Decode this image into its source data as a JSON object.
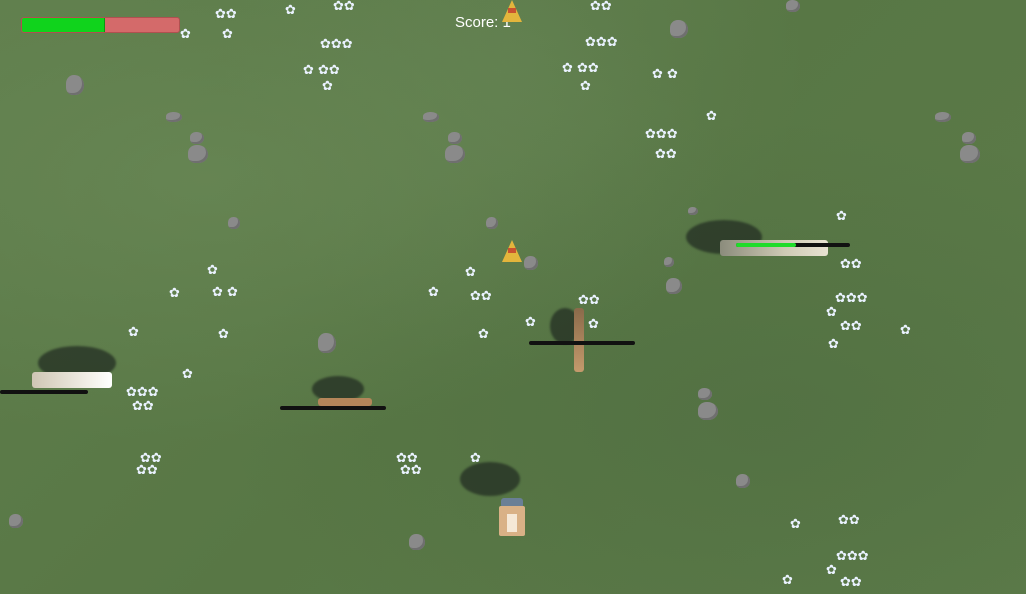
{
  "hud": {
    "score_text": "Score: 1",
    "player_health_fraction": 0.52
  },
  "enemies": [
    {
      "name": "enemy-left",
      "health_fraction": 0
    },
    {
      "name": "enemy-middle",
      "health_fraction": 0
    },
    {
      "name": "enemy-center",
      "health_fraction": 0
    },
    {
      "name": "enemy-right",
      "health_fraction": 0.53
    }
  ],
  "colors": {
    "grass": "#5b7a49",
    "health_fill": "#10d31c",
    "health_empty": "#d46a6a",
    "bar_track": "#111111",
    "rock": "#8a8a8a",
    "flower": "#eaf2ff",
    "pickup_cone": "#e3b53c"
  },
  "icons": {
    "pickup": "traffic-cone-icon",
    "flower": "flower-icon",
    "rock": "rock-icon"
  }
}
